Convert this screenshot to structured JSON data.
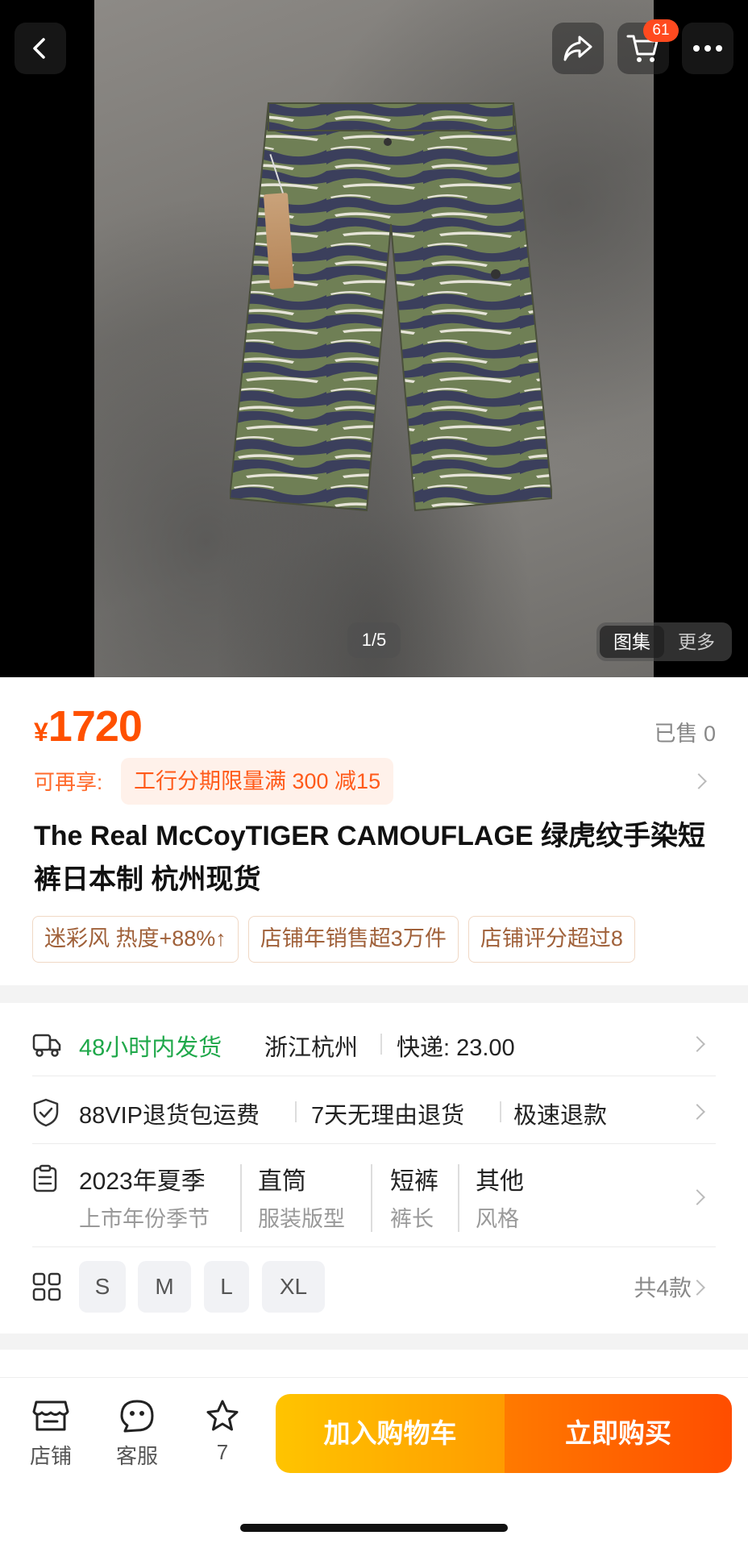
{
  "hero": {
    "counter": "1/5",
    "gallery_tabs": [
      "图集",
      "更多"
    ],
    "cart_badge": "61"
  },
  "icons": {
    "back": "chevron-left-icon",
    "share": "share-icon",
    "cart": "cart-icon",
    "more": "more-dots-icon"
  },
  "product": {
    "currency": "¥",
    "price": "1720",
    "sold": "已售 0",
    "promo_label": "可再享:",
    "promo_text": "工行分期限量满 300 减15",
    "title": "The Real McCoyTIGER CAMOUFLAGE 绿虎纹手染短裤日本制 杭州现货",
    "chips": [
      "迷彩风 热度+88%↑",
      "店铺年销售超3万件",
      "店铺评分超过8"
    ]
  },
  "shipping": {
    "badge": "48小时内发货",
    "from": "浙江杭州",
    "fee": "快递: 23.00"
  },
  "services": [
    "88VIP退货包运费",
    "7天无理由退货",
    "极速退款"
  ],
  "attributes": [
    {
      "value": "2023年夏季",
      "key": "上市年份季节"
    },
    {
      "value": "直筒",
      "key": "服装版型"
    },
    {
      "value": "短裤",
      "key": "裤长"
    },
    {
      "value": "其他",
      "key": "风格"
    }
  ],
  "sizes": {
    "options": [
      "S",
      "M",
      "L",
      "XL"
    ],
    "count": "共4款"
  },
  "bottom_bar": {
    "store": "店铺",
    "service": "客服",
    "favorites": "7",
    "add_to_cart": "加入购物车",
    "buy_now": "立即购买"
  },
  "colors": {
    "accent": "#ff5000",
    "green": "#1fa84a",
    "cart_gradient": [
      "#ffc400",
      "#ff9c00"
    ],
    "buy_gradient": [
      "#ff7a00",
      "#ff4d00"
    ]
  }
}
